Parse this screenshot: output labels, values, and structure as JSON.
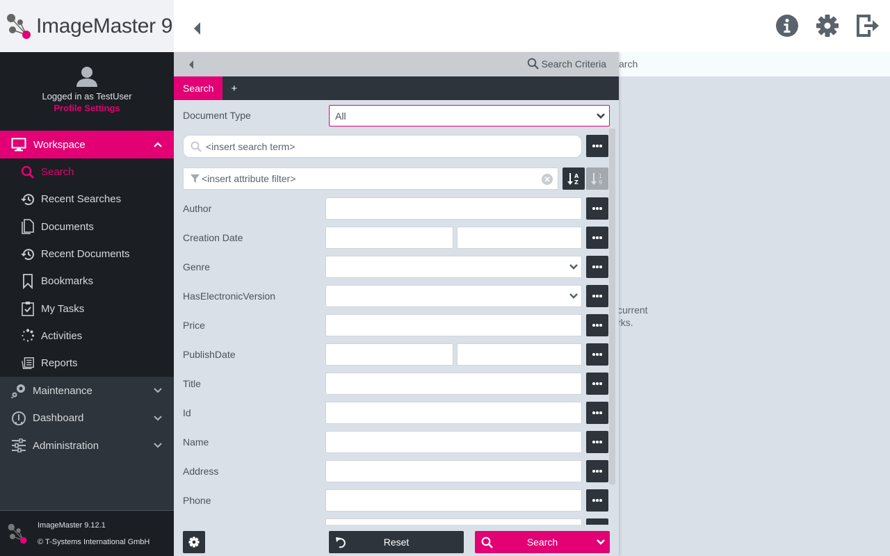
{
  "app": {
    "title": "ImageMaster 9",
    "brand_color": "#e20074"
  },
  "topbar": {
    "icons": [
      "info-icon",
      "gear-icon",
      "logout-icon"
    ]
  },
  "user": {
    "logged_in_text": "Logged in as TestUser",
    "profile_link": "Profile Settings"
  },
  "sidebar": {
    "workspace": {
      "label": "Workspace",
      "expanded": true,
      "items": [
        {
          "label": "Search",
          "icon": "search-icon",
          "active": true
        },
        {
          "label": "Recent Searches",
          "icon": "history-icon"
        },
        {
          "label": "Documents",
          "icon": "documents-icon"
        },
        {
          "label": "Recent Documents",
          "icon": "history-icon"
        },
        {
          "label": "Bookmarks",
          "icon": "bookmark-icon"
        },
        {
          "label": "My Tasks",
          "icon": "clipboard-check-icon"
        },
        {
          "label": "Activities",
          "icon": "spinner-icon"
        },
        {
          "label": "Reports",
          "icon": "reports-icon"
        }
      ]
    },
    "groups": [
      {
        "label": "Maintenance",
        "icon": "gears-icon"
      },
      {
        "label": "Dashboard",
        "icon": "gauge-icon"
      },
      {
        "label": "Administration",
        "icon": "sliders-icon"
      }
    ],
    "footer": {
      "version": "ImageMaster 9.12.1",
      "copyright": "© T-Systems International GmbH"
    }
  },
  "background": {
    "strip_text": "arch",
    "message_line1": "current",
    "message_line2": "rks."
  },
  "panel": {
    "header_label": "Search Criteria",
    "tabs": [
      {
        "label": "Search",
        "active": true
      },
      {
        "label": "+"
      }
    ],
    "document_type": {
      "label": "Document Type",
      "value": "All"
    },
    "search_term_placeholder": "<insert search term>",
    "attribute_filter_placeholder": "<insert attribute filter>",
    "sort_alpha_active": true,
    "fields": [
      {
        "label": "Author",
        "type": "text"
      },
      {
        "label": "Creation Date",
        "type": "range"
      },
      {
        "label": "Genre",
        "type": "select"
      },
      {
        "label": "HasElectronicVersion",
        "type": "select"
      },
      {
        "label": "Price",
        "type": "text"
      },
      {
        "label": "PublishDate",
        "type": "range"
      },
      {
        "label": "Title",
        "type": "text"
      },
      {
        "label": "Id",
        "type": "text"
      },
      {
        "label": "Name",
        "type": "text"
      },
      {
        "label": "Address",
        "type": "text"
      },
      {
        "label": "Phone",
        "type": "text"
      },
      {
        "label": "",
        "type": "text"
      }
    ],
    "buttons": {
      "reset": "Reset",
      "search": "Search"
    }
  }
}
